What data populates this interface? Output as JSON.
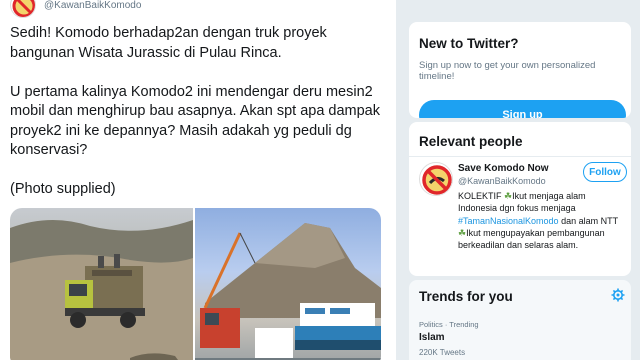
{
  "tweet": {
    "author_handle": "@KawanBaikKomodo",
    "paragraphs": [
      "Sedih! Komodo berhadap2an dengan truk proyek bangunan Wisata Jurassic di Pulau Rinca.",
      "U pertama kalinya Komodo2 ini mendengar deru mesin2 mobil dan menghirup bau asapnya. Akan spt apa dampak proyek2 ini ke depannya? Masih adakah yg peduli dg konservasi?",
      "(Photo supplied)"
    ]
  },
  "sidebar": {
    "new_to_twitter": {
      "title": "New to Twitter?",
      "subtitle": "Sign up now to get your own personalized timeline!",
      "signup_label": "Sign up",
      "accent": "#1da1f2"
    },
    "relevant_people": {
      "title": "Relevant people",
      "person": {
        "name": "Save Komodo Now",
        "handle": "@KawanBaikKomodo",
        "follow_label": "Follow",
        "bio_parts": {
          "p1": "KOLEKTIF ",
          "p2": "Ikut menjaga alam Indonesia dgn fokus menjaga ",
          "hashtag": "#TamanNasionalKomodo",
          "p3": " dan alam NTT ",
          "p4": "Ikut mengupayakan pembangunan berkeadilan dan selaras alam."
        }
      }
    },
    "trends": {
      "title": "Trends for you",
      "items": [
        {
          "meta": "Politics · Trending",
          "name": "Islam",
          "count": "220K Tweets"
        }
      ]
    }
  },
  "icons": {
    "no_symbol": "no-symbol-icon",
    "sprout": "sprout-icon",
    "gear": "gear-icon"
  },
  "colors": {
    "accent": "#1da1f2",
    "no_sign_red": "#e0262a",
    "background": "#e6ecf0"
  }
}
